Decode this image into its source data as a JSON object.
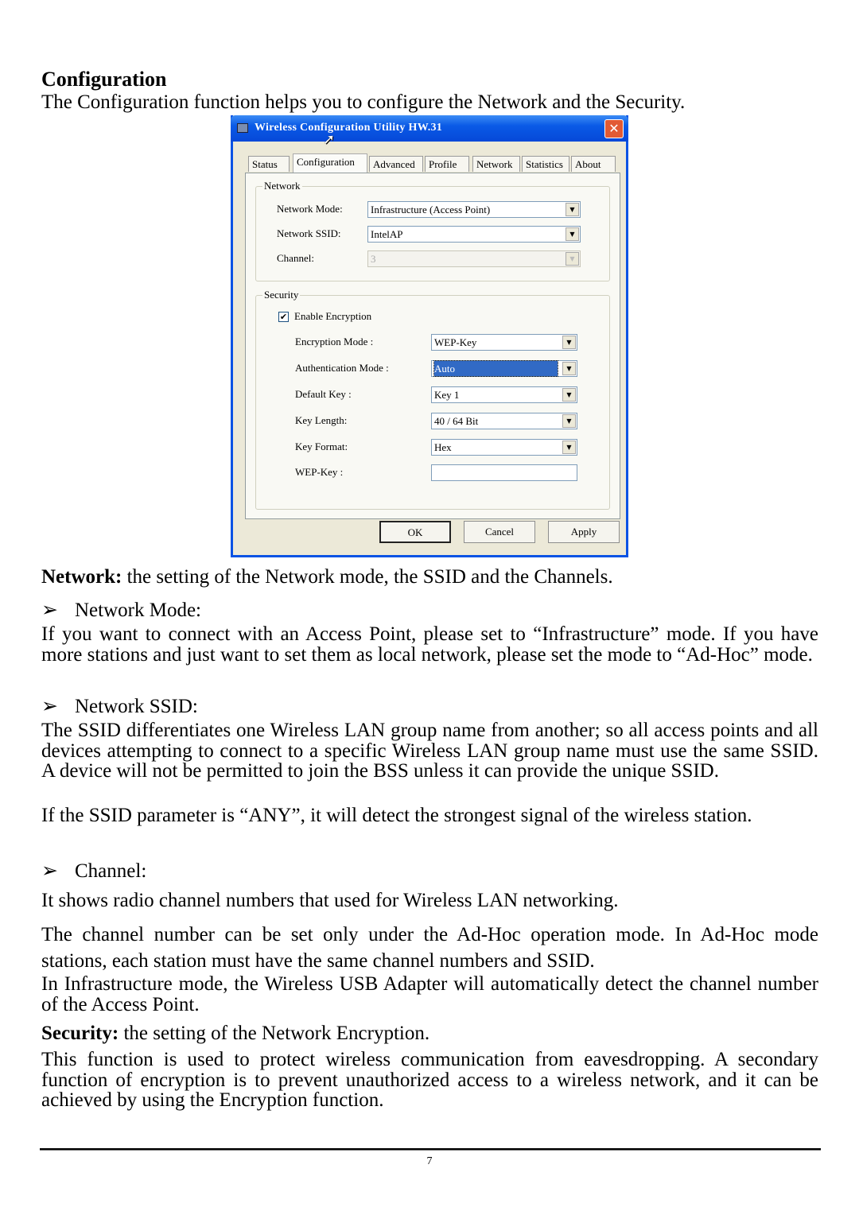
{
  "heading": "Configuration",
  "intro": "The Configuration function helps you to configure the Network and the Security.",
  "dialog": {
    "title": "Wireless Configuration Utility HW.31",
    "close_icon": "close-icon",
    "tabs": [
      "Status",
      "Configuration",
      "Advanced",
      "Profile",
      "Network",
      "Statistics",
      "About"
    ],
    "active_tab": "Configuration",
    "network_group": {
      "legend": "Network",
      "network_mode_label": "Network Mode:",
      "network_mode_value": "Infrastructure (Access Point)",
      "ssid_label": "Network SSID:",
      "ssid_value": "IntelAP",
      "channel_label": "Channel:",
      "channel_value": "3"
    },
    "security_group": {
      "legend": "Security",
      "enable_encryption_label": "Enable Encryption",
      "enable_encryption_checked": true,
      "check_mark": "✔",
      "encryption_mode_label": "Encryption Mode :",
      "encryption_mode_value": "WEP-Key",
      "auth_mode_label": "Authentication Mode :",
      "auth_mode_value": "Auto",
      "default_key_label": "Default Key :",
      "default_key_value": "Key 1",
      "key_length_label": "Key Length:",
      "key_length_value": "40 / 64 Bit",
      "key_format_label": "Key Format:",
      "key_format_value": "Hex",
      "wep_key_label": "WEP-Key :",
      "wep_key_value": ""
    },
    "buttons": {
      "ok": "OK",
      "cancel": "Cancel",
      "apply": "Apply"
    }
  },
  "network_section": {
    "label": "Network:",
    "text": " the setting of the Network mode, the SSID and the Channels."
  },
  "bullets": {
    "arrow": "➢",
    "network_mode": "Network Mode:",
    "network_ssid": "Network SSID:",
    "channel": "Channel:"
  },
  "paragraphs": {
    "network_mode": "If you want to connect with an Access Point, please set to “Infrastructure” mode. If you have more stations and just want to set them as local network, please set the mode to “Ad-Hoc” mode.",
    "ssid_1": "The SSID differentiates one Wireless LAN group name from another; so all access points and all devices attempting to connect to a specific Wireless LAN group name must use the same SSID. A device will not be permitted to join the BSS unless it can provide the unique SSID.",
    "ssid_2": "If the SSID parameter is “ANY”, it will detect the strongest signal of the wireless station.",
    "channel_1": "It shows radio channel numbers that used for Wireless LAN networking.",
    "channel_2": "The channel number can be set only under the Ad-Hoc operation mode. In Ad-Hoc mode stations, each station must have the same channel numbers and SSID.",
    "channel_3": "In Infrastructure mode, the Wireless USB Adapter will automatically detect the channel number of the Access Point.",
    "security": "This function is used to protect wireless communication from eavesdropping. A secondary function of encryption is to prevent unauthorized access to a wireless network, and it can be achieved by using the Encryption function."
  },
  "security_section": {
    "label": "Security:",
    "text": " the setting of the Network Encryption."
  },
  "page_number": "7"
}
